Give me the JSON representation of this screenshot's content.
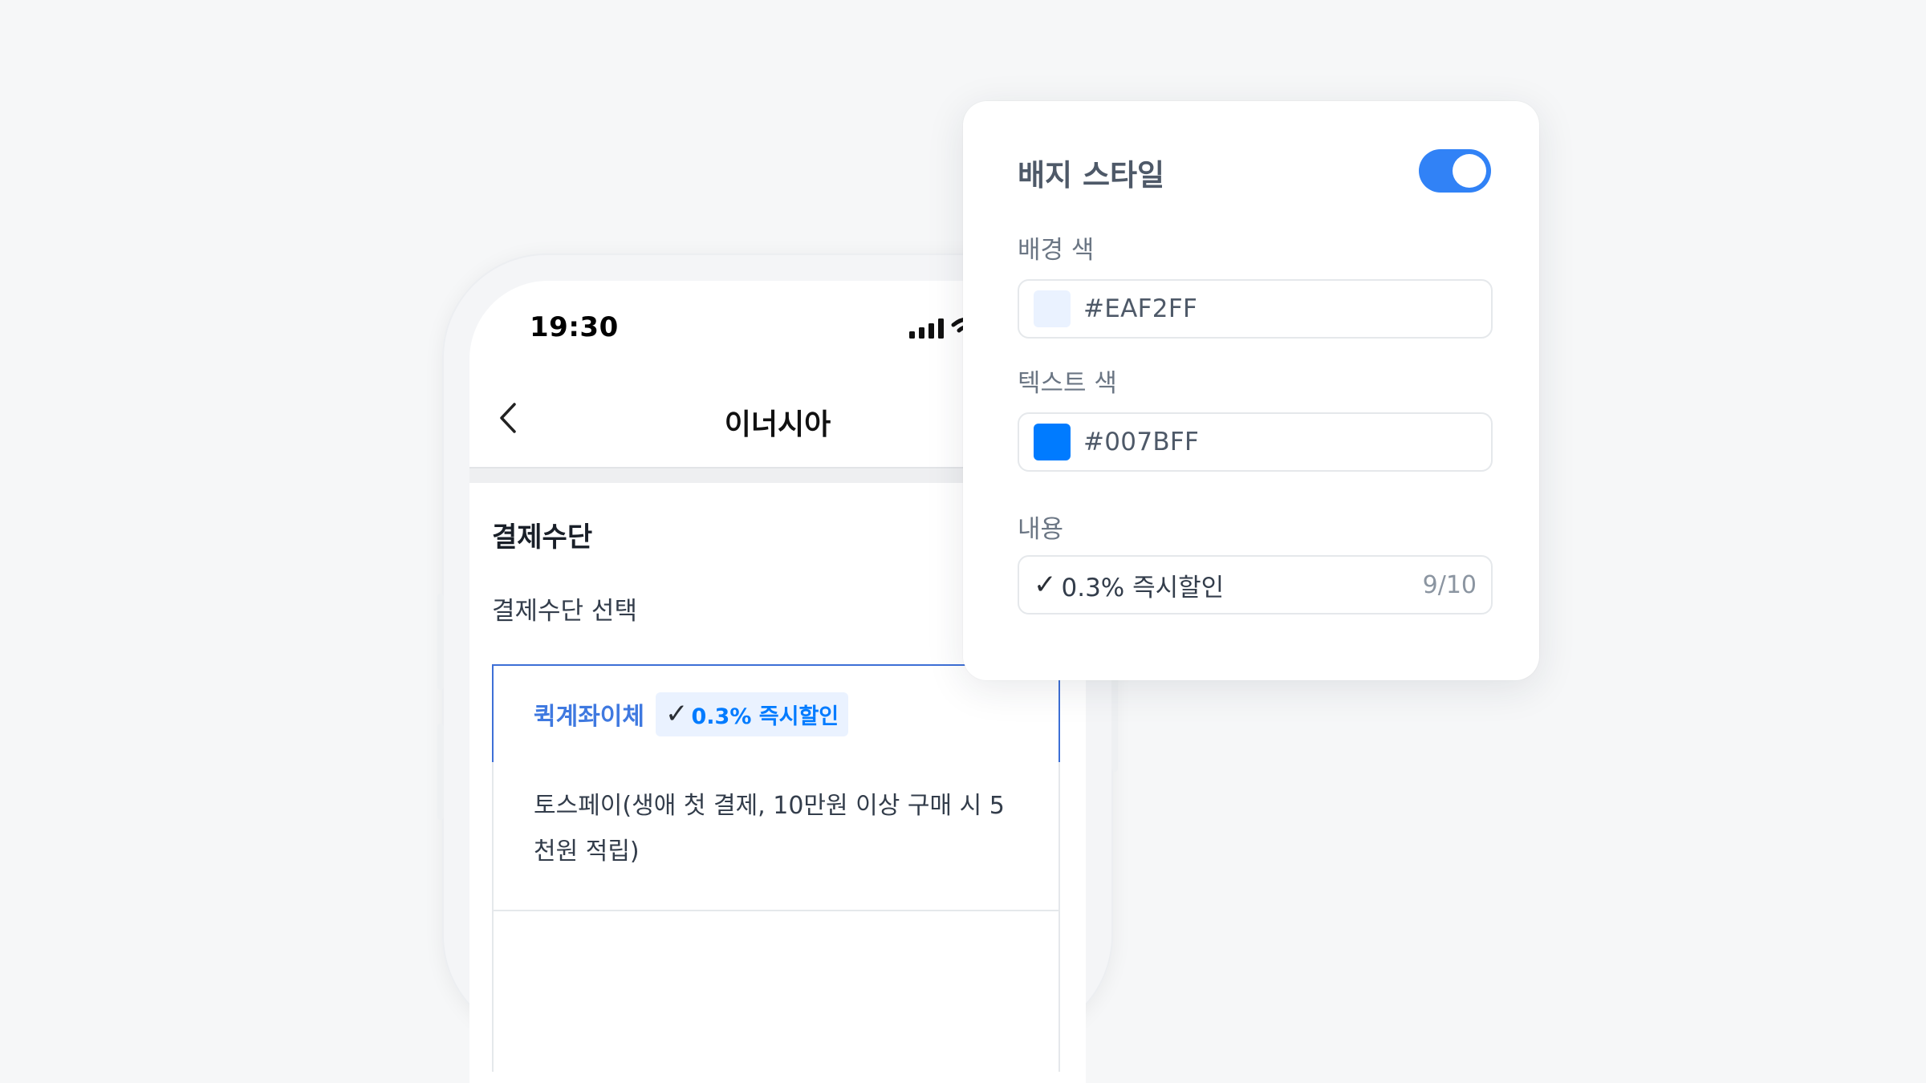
{
  "phone": {
    "time": "19:30",
    "title": "이너시아",
    "section_title": "결제수단",
    "section_subtitle": "결제수단 선택",
    "selected_option": {
      "name": "퀵계좌이체",
      "badge_check": "✓",
      "badge_text": "0.3% 즉시할인"
    },
    "option_2": "토스페이(생애 첫 결제, 10만원 이상 구매 시 5천원 적립)"
  },
  "panel": {
    "title": "배지 스타일",
    "toggle_on": true,
    "background_color": {
      "label": "배경 색",
      "value": "#EAF2FF"
    },
    "text_color": {
      "label": "텍스트 색",
      "value": "#007BFF"
    },
    "content": {
      "label": "내용",
      "check": "✓",
      "value": "0.3% 즉시할인",
      "counter": "9/10"
    }
  },
  "colors": {
    "accent": "#3182f6",
    "selected_border": "#3d6fd6",
    "badge_bg": "#EAF2FF",
    "badge_text": "#007BFF"
  },
  "icons": [
    "signal-icon",
    "wifi-icon",
    "back-chevron-icon",
    "check-icon"
  ]
}
